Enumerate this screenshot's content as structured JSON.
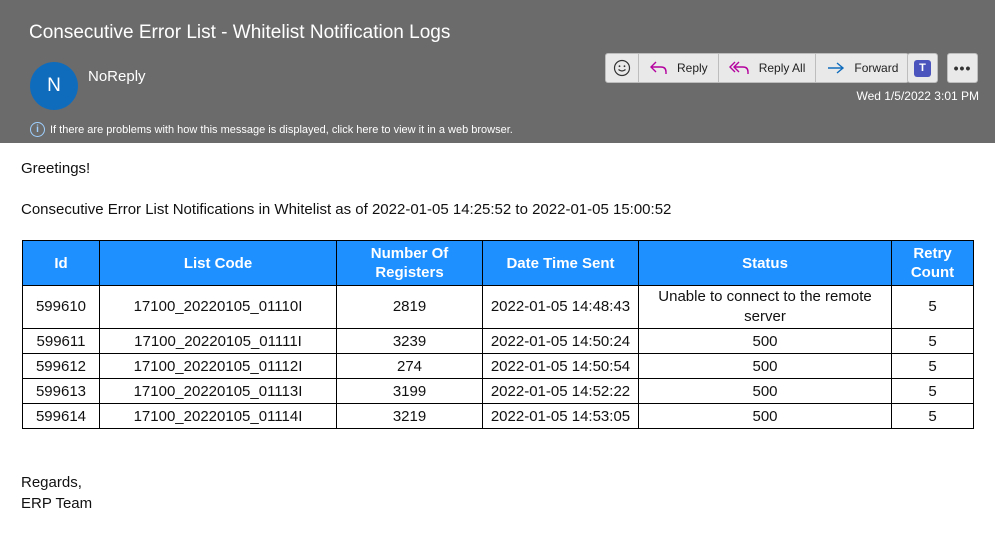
{
  "email": {
    "subject": "Consecutive Error List - Whitelist Notification Logs",
    "sender_initial": "N",
    "sender": "NoReply",
    "date": "Wed 1/5/2022 3:01 PM",
    "info_text": "If there are problems with how this message is displayed, click here to view it in a web browser."
  },
  "toolbar": {
    "reply_label": "Reply",
    "reply_all_label": "Reply All",
    "forward_label": "Forward",
    "more_label": "•••",
    "teams_label": "T"
  },
  "message": {
    "greeting": "Greetings!",
    "intro": "Consecutive Error List Notifications in Whitelist as of 2022-01-05 14:25:52 to 2022-01-05 15:00:52",
    "regards": "Regards,",
    "team": "ERP Team"
  },
  "table": {
    "headers": [
      "Id",
      "List Code",
      "Number Of Registers",
      "Date Time Sent",
      "Status",
      "Retry Count"
    ],
    "header_lines": {
      "registers_1": "Number Of",
      "registers_2": "Registers",
      "retry_1": "Retry",
      "retry_2": "Count"
    },
    "rows": [
      {
        "id": "599610",
        "code": "17100_20220105_01110I",
        "registers": "2819",
        "sent": "2022-01-05 14:48:43",
        "status": "Unable to connect to the remote server",
        "retry": "5"
      },
      {
        "id": "599611",
        "code": "17100_20220105_01111I",
        "registers": "3239",
        "sent": "2022-01-05 14:50:24",
        "status": "500",
        "retry": "5"
      },
      {
        "id": "599612",
        "code": "17100_20220105_01112I",
        "registers": "274",
        "sent": "2022-01-05 14:50:54",
        "status": "500",
        "retry": "5"
      },
      {
        "id": "599613",
        "code": "17100_20220105_01113I",
        "registers": "3199",
        "sent": "2022-01-05 14:52:22",
        "status": "500",
        "retry": "5"
      },
      {
        "id": "599614",
        "code": "17100_20220105_01114I",
        "registers": "3219",
        "sent": "2022-01-05 14:53:05",
        "status": "500",
        "retry": "5"
      }
    ]
  },
  "colors": {
    "header_bg": "#6b6b6b",
    "avatar": "#0f6cbd",
    "table_header": "#1e90ff",
    "reply_accent": "#b4009e",
    "forward_accent": "#0f6cbd",
    "teams": "#4b53bc"
  }
}
